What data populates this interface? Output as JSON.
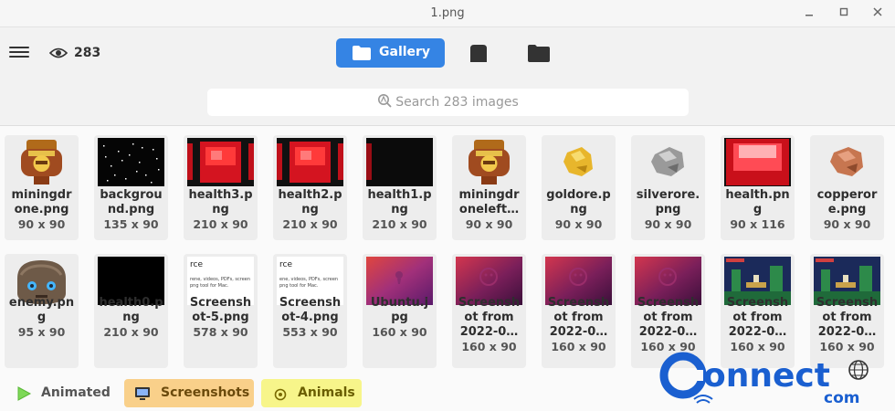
{
  "window": {
    "title": "1.png"
  },
  "toolbar": {
    "view_count": "283",
    "gallery_label": "Gallery"
  },
  "search": {
    "placeholder": "Search 283 images"
  },
  "tiles": [
    {
      "name": "miningdr\none.png",
      "dims": "90 x 90",
      "thumb": "miner"
    },
    {
      "name": "backgrou\nnd.png",
      "dims": "135 x 90",
      "thumb": "stars"
    },
    {
      "name": "health3.p\nng",
      "dims": "210 x 90",
      "thumb": "health-red"
    },
    {
      "name": "health2.p\nng",
      "dims": "210 x 90",
      "thumb": "health-red"
    },
    {
      "name": "health1.p\nng",
      "dims": "210 x 90",
      "thumb": "health-dark"
    },
    {
      "name": "miningdr\noneleft…",
      "dims": "90 x 90",
      "thumb": "miner"
    },
    {
      "name": "goldore.p\nng",
      "dims": "90 x 90",
      "thumb": "gold-ore"
    },
    {
      "name": "silverore.\npng",
      "dims": "90 x 90",
      "thumb": "silver-ore"
    },
    {
      "name": "health.pn\ng",
      "dims": "90 x 116",
      "thumb": "health-tall"
    },
    {
      "name": "copperor\ne.png",
      "dims": "90 x 90",
      "thumb": "copper-ore"
    },
    {
      "name": "enemy.pn\ng",
      "dims": "95 x 90",
      "thumb": "enemy"
    },
    {
      "name": "health0.p\nng",
      "dims": "210 x 90",
      "thumb": "black"
    },
    {
      "name": "Screensh\not-5.png",
      "dims": "578 x 90",
      "thumb": "doc",
      "doc_title": "rce",
      "doc_text": "rene, videos, PDFs, screen\npng tool for Mac."
    },
    {
      "name": "Screensh\not-4.png",
      "dims": "553 x 90",
      "thumb": "doc",
      "doc_title": "rce",
      "doc_text": "ene, videos, PDFs, screen\npng tool for Mac."
    },
    {
      "name": "Ubuntu.j\npg",
      "dims": "160 x 90",
      "thumb": "ubuntu"
    },
    {
      "name": "Screensh\not from\n2022-0…",
      "dims": "160 x 90",
      "thumb": "wallpaper"
    },
    {
      "name": "Screensh\not from\n2022-0…",
      "dims": "160 x 90",
      "thumb": "wallpaper"
    },
    {
      "name": "Screensh\not from\n2022-0…",
      "dims": "160 x 90",
      "thumb": "wallpaper"
    },
    {
      "name": "Screensh\not from\n2022-0…",
      "dims": "160 x 90",
      "thumb": "game"
    },
    {
      "name": "Screensh\not from\n2022-0…",
      "dims": "160 x 90",
      "thumb": "game"
    }
  ],
  "filters": [
    {
      "label": "Animated",
      "icon": "play-icon",
      "color": "#fafafa"
    },
    {
      "label": "Screenshots",
      "icon": "monitor-icon",
      "color": "#f9d08a"
    },
    {
      "label": "Animals",
      "icon": "paw-icon",
      "color": "#f7f58a"
    }
  ],
  "watermark": {
    "brand": "onnect",
    "domain": "com"
  }
}
